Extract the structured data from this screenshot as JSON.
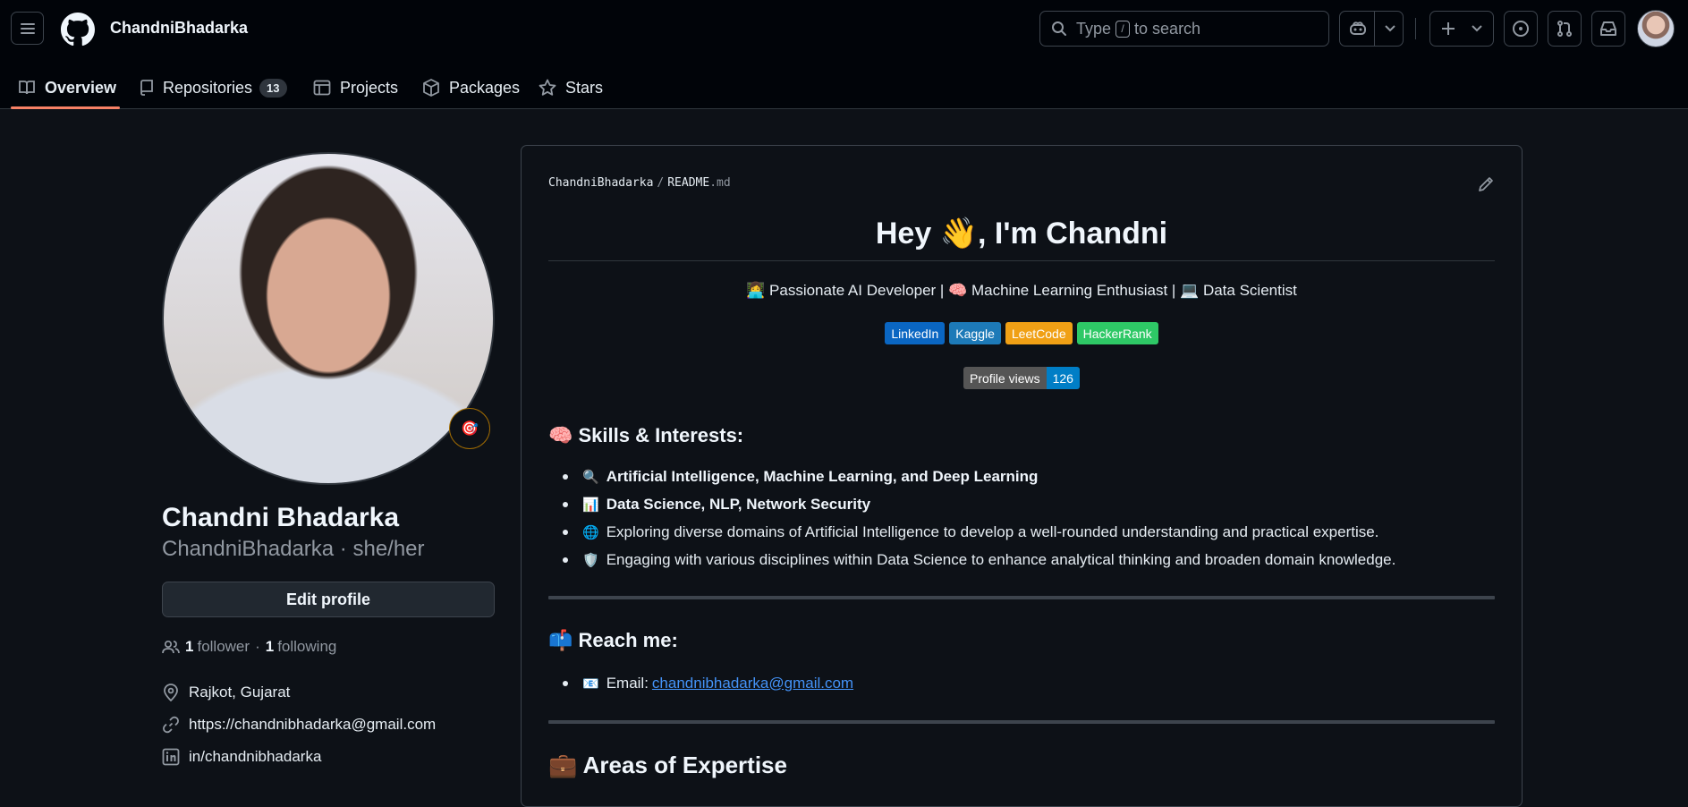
{
  "header": {
    "username": "ChandniBhadarka",
    "search_prefix": "Type",
    "search_key": "/",
    "search_suffix": "to search"
  },
  "tabs": [
    {
      "label": "Overview",
      "icon": "book-icon",
      "active": true
    },
    {
      "label": "Repositories",
      "icon": "repo-icon",
      "count": "13"
    },
    {
      "label": "Projects",
      "icon": "table-icon"
    },
    {
      "label": "Packages",
      "icon": "package-icon"
    },
    {
      "label": "Stars",
      "icon": "star-icon"
    }
  ],
  "profile": {
    "status_emoji": "🎯",
    "full_name": "Chandni Bhadarka",
    "login_line": "ChandniBhadarka · she/her",
    "edit_label": "Edit profile",
    "followers_count": "1",
    "followers_label": "follower",
    "separator": "·",
    "following_count": "1",
    "following_label": "following",
    "location": "Rajkot, Gujarat",
    "website": "https://chandnibhadarka@gmail.com",
    "linkedin": "in/chandnibhadarka"
  },
  "readme": {
    "owner": "ChandniBhadarka",
    "slash": "/",
    "file_name": "README",
    "file_ext": ".md",
    "title": "Hey 👋, I'm Chandni",
    "tagline": "👩‍💻 Passionate AI Developer | 🧠 Machine Learning Enthusiast | 💻 Data Scientist",
    "badges": [
      {
        "label": "LinkedIn",
        "color": "#0a66c2"
      },
      {
        "label": "Kaggle",
        "color": "#1d7ab8"
      },
      {
        "label": "LeetCode",
        "color": "#f0a015"
      },
      {
        "label": "HackerRank",
        "color": "#2ec866"
      }
    ],
    "views_label": "Profile views",
    "views_count": "126",
    "skills_heading": "🧠 Skills & Interests:",
    "skills": [
      {
        "icon": "🔍",
        "text": "Artificial Intelligence, Machine Learning, and Deep Learning",
        "bold": true
      },
      {
        "icon": "📊",
        "text": "Data Science, NLP, Network Security",
        "bold": true
      },
      {
        "icon": "🌐",
        "text": "Exploring diverse domains of Artificial Intelligence to develop a well-rounded understanding and practical expertise.",
        "bold": false
      },
      {
        "icon": "🛡️",
        "text": "Engaging with various disciplines within Data Science to enhance analytical thinking and broaden domain knowledge.",
        "bold": false
      }
    ],
    "reach_heading": "📫 Reach me:",
    "email_icon": "📧",
    "email_label": "Email:",
    "email": "chandnibhadarka@gmail.com",
    "expertise_heading": "💼 Areas of Expertise"
  }
}
